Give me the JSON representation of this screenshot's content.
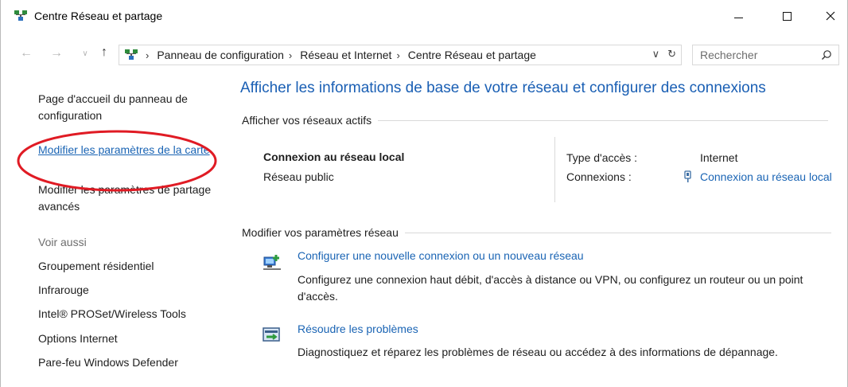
{
  "window": {
    "title": "Centre Réseau et partage",
    "icon": "network-center-icon"
  },
  "address_bar": {
    "crumbs": [
      "Panneau de configuration",
      "Réseau et Internet",
      "Centre Réseau et partage"
    ],
    "search_placeholder": "Rechercher"
  },
  "left_pane": {
    "home_link": "Page d'accueil du panneau de configuration",
    "adapter_link": "Modifier les paramètres de la carte",
    "sharing_link": "Modifier les paramètres de partage avancés",
    "see_also_label": "Voir aussi",
    "see_also": [
      "Groupement résidentiel",
      "Infrarouge",
      "Intel® PROSet/Wireless Tools",
      "Options Internet",
      "Pare-feu Windows Defender"
    ]
  },
  "main": {
    "title": "Afficher les informations de base de votre réseau et configurer des connexions",
    "active_networks_heading": "Afficher vos réseaux actifs",
    "network": {
      "name": "Connexion au réseau local",
      "category": "Réseau public",
      "access_type_label": "Type d'accès :",
      "access_type_value": "Internet",
      "connections_label": "Connexions :",
      "connections_value": "Connexion au réseau local"
    },
    "modify_heading": "Modifier vos paramètres réseau",
    "tasks": [
      {
        "link": "Configurer une nouvelle connexion ou un nouveau réseau",
        "desc": "Configurez une connexion haut débit, d'accès à distance ou VPN, ou configurez un routeur ou un point d'accès.",
        "icon": "new-connection-icon"
      },
      {
        "link": "Résoudre les problèmes",
        "desc": "Diagnostiquez et réparez les problèmes de réseau ou accédez à des informations de dépannage.",
        "icon": "troubleshoot-icon"
      }
    ]
  },
  "colors": {
    "link": "#1a64b4",
    "title": "#1a5fb4",
    "annotation": "#e01b24"
  }
}
